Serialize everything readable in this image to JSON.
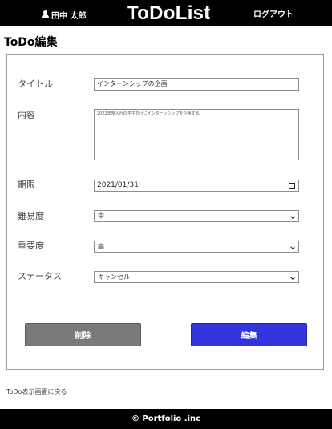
{
  "header": {
    "user_name": "田中 太郎",
    "app_title": "ToDoList",
    "logout_label": "ログアウト",
    "user_icon": "user-icon"
  },
  "page": {
    "title": "ToDo編集"
  },
  "form": {
    "title_label": "タイトル",
    "title_value": "インターンシップの企画",
    "content_label": "内容",
    "content_value": "2022年度入社の学生向けにインターンシップを企画する。",
    "deadline_label": "期限",
    "deadline_value": "2021/01/31",
    "difficulty_label": "難易度",
    "difficulty_value": "中",
    "importance_label": "重要度",
    "importance_value": "高",
    "status_label": "ステータス",
    "status_value": "キャンセル"
  },
  "actions": {
    "delete_label": "削除",
    "edit_label": "編集"
  },
  "links": {
    "back_label": "ToDo表示画面に戻る"
  },
  "footer": {
    "copyright": "© Portfolio .inc"
  },
  "colors": {
    "header_bg": "#000000",
    "delete_button": "#7a7a7a",
    "edit_button": "#3334dd"
  }
}
